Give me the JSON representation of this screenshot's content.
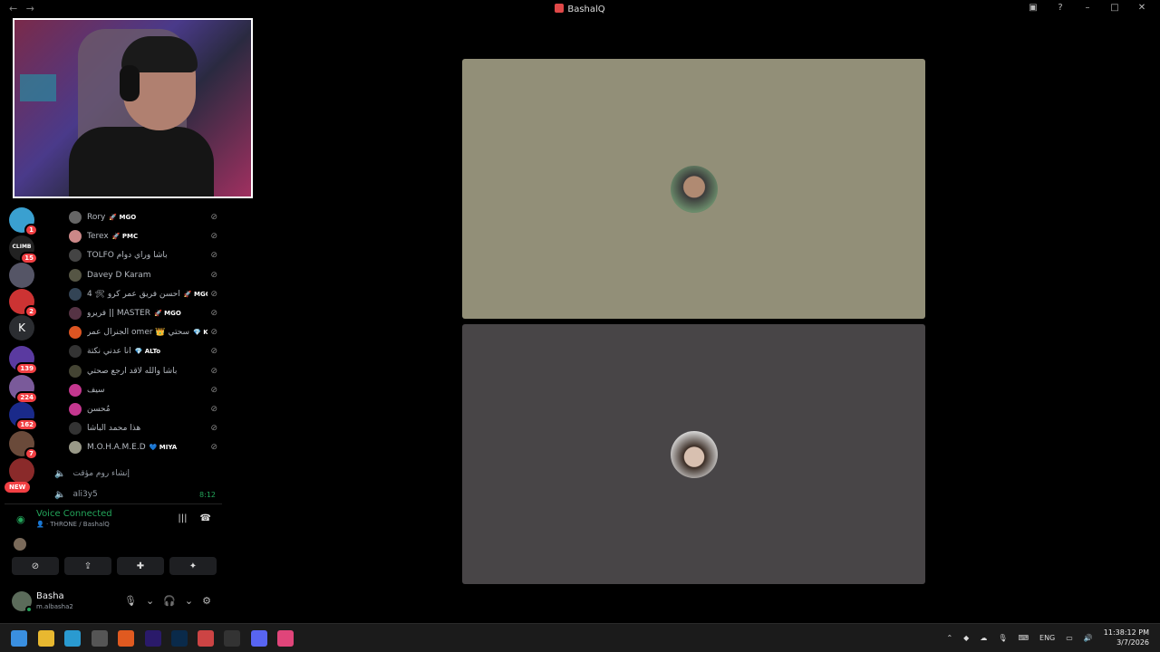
{
  "window": {
    "title": "BashalQ",
    "back_icon": "←",
    "forward_icon": "→",
    "controls": [
      "screen-icon",
      "help-icon",
      "minimize-icon",
      "maximize-icon",
      "close-icon"
    ]
  },
  "servers": [
    {
      "badge": "1",
      "color": "#3aa0d0"
    },
    {
      "badge": "15",
      "color": "#222",
      "label": "CLIMB"
    },
    {
      "badge": "",
      "color": "#556"
    },
    {
      "badge": "2",
      "color": "#c33"
    },
    {
      "badge": "",
      "color": "#2b2d31",
      "label": "K"
    },
    {
      "badge": "139",
      "color": "#5a3aa0"
    },
    {
      "badge": "224",
      "color": "#7a5a9a"
    },
    {
      "badge": "162",
      "color": "#1a2a8a"
    },
    {
      "badge": "7",
      "color": "#6a4a3a"
    },
    {
      "badge": "",
      "color": "#8a2a2a"
    }
  ],
  "new_badge": "NEW",
  "members": [
    {
      "name": "Rory",
      "tag": "🚀 MGO",
      "avatar": "#666"
    },
    {
      "name": "Terex",
      "tag": "🚀 PMC",
      "avatar": "#c88"
    },
    {
      "name": "TOLFO باشا وراي دوام",
      "tag": "",
      "avatar": "#444"
    },
    {
      "name": "Davey D Karam",
      "tag": "",
      "avatar": "#554"
    },
    {
      "name": "4 🛠 احسن فريق عمر كرو",
      "tag": "🚀 MGO",
      "avatar": "#345"
    },
    {
      "name": "فريرو || MASTER",
      "tag": "🚀 MGO",
      "avatar": "#534"
    },
    {
      "name": "الجنرال عمر omer 👑 سحتي",
      "tag": "💎 K",
      "avatar": "#d52"
    },
    {
      "name": "انا عدني نكتة",
      "tag": "💎 ALTo",
      "avatar": "#333"
    },
    {
      "name": "باشا والله لاقد ارجع صحتي",
      "tag": "",
      "avatar": "#443"
    },
    {
      "name": "سيف",
      "tag": "",
      "avatar": "#c4378f"
    },
    {
      "name": "مُحسن",
      "tag": "",
      "avatar": "#c4378f"
    },
    {
      "name": "هذا محمد الباشا",
      "tag": "",
      "avatar": "#333"
    },
    {
      "name": "M.O.H.A.M.E.D",
      "tag": "💙 MIYA",
      "avatar": "#998"
    }
  ],
  "channels": [
    {
      "name": "إنشاء روم مؤقت",
      "time": ""
    },
    {
      "name": "ali3y5",
      "time": "8:12"
    }
  ],
  "voice": {
    "status": "Voice Connected",
    "location": "THRONE / BashalQ"
  },
  "user": {
    "name": "Basha",
    "handle": "m.albasha2"
  },
  "clock": {
    "time": "11:38:12 PM",
    "date": "3/7/2026"
  },
  "tray": {
    "lang": "ENG"
  },
  "colors": {
    "tile_top": "#928f78",
    "tile_bottom": "#484547",
    "connected": "#23a55a",
    "badge": "#f23f43"
  }
}
